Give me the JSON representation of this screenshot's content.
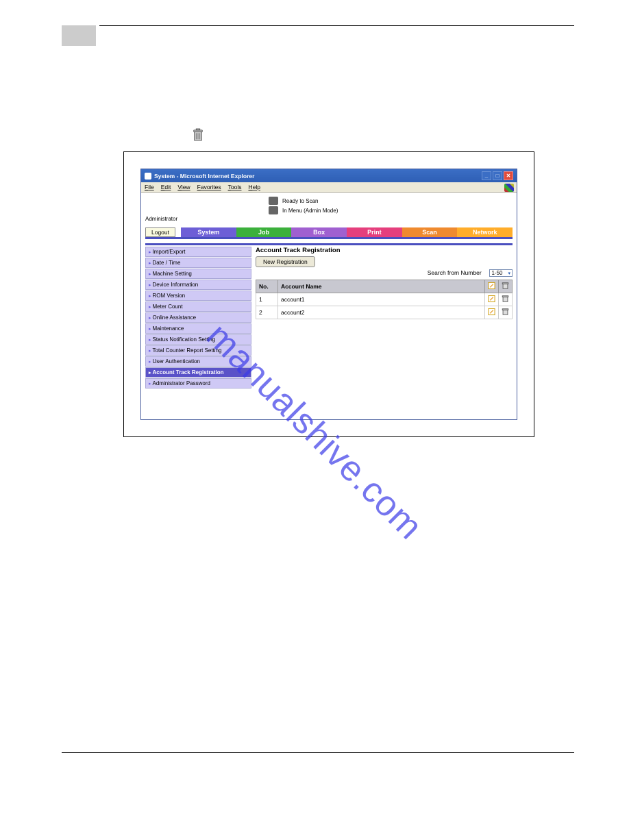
{
  "window": {
    "title": "System - Microsoft Internet Explorer",
    "menubar": [
      "File",
      "Edit",
      "View",
      "Favorites",
      "Tools",
      "Help"
    ]
  },
  "status": {
    "line1": "Ready to Scan",
    "line2": "In Menu (Admin Mode)"
  },
  "admin": {
    "label": "Administrator",
    "logout": "Logout"
  },
  "tabs": {
    "system": "System",
    "job": "Job",
    "box": "Box",
    "print": "Print",
    "scan": "Scan",
    "network": "Network"
  },
  "sidebar": {
    "items": [
      "Import/Export",
      "Date / Time",
      "Machine Setting",
      "Device Information",
      "ROM Version",
      "Meter Count",
      "Online Assistance",
      "Maintenance",
      "Status Notification Setting",
      "Total Counter Report Setting",
      "User Authentication",
      "Account Track Registration",
      "Administrator Password"
    ],
    "selected": 11
  },
  "panel": {
    "title": "Account Track Registration",
    "new_reg": "New Registration",
    "search_label": "Search from Number",
    "search_value": "1-50",
    "headers": {
      "no": "No.",
      "name": "Account Name"
    },
    "rows": [
      {
        "no": "1",
        "name": "account1"
      },
      {
        "no": "2",
        "name": "account2"
      }
    ]
  },
  "watermark": "manualshive.com"
}
